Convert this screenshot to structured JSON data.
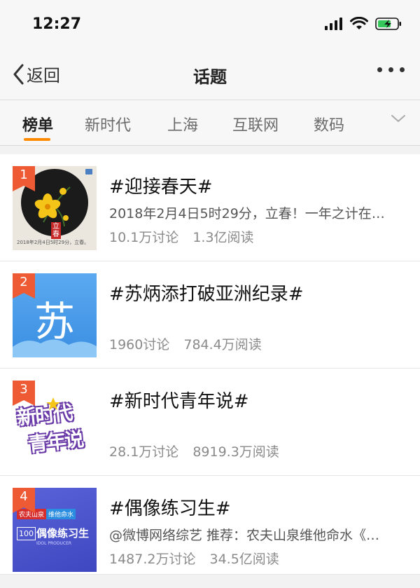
{
  "status": {
    "time": "12:27"
  },
  "nav": {
    "back_label": "返回",
    "title": "话题"
  },
  "tabs": [
    {
      "label": "榜单",
      "active": true
    },
    {
      "label": "新时代"
    },
    {
      "label": "上海"
    },
    {
      "label": "互联网"
    },
    {
      "label": "数码"
    }
  ],
  "topics": [
    {
      "rank": "1",
      "title": "#迎接春天#",
      "description": "2018年2月4日5时29分，立春！一年之计在…",
      "discussions": "10.1万讨论",
      "reads": "1.3亿阅读",
      "thumb_caption": "2018年2月4日5时29分，立春。",
      "thumb_stamp": "立春"
    },
    {
      "rank": "2",
      "title": "#苏炳添打破亚洲纪录#",
      "description": "",
      "discussions": "1960讨论",
      "reads": "784.4万阅读",
      "thumb_text": "苏"
    },
    {
      "rank": "3",
      "title": "#新时代青年说#",
      "description": "",
      "discussions": "28.1万讨论",
      "reads": "8919.3万阅读",
      "thumb_line1": "新时代",
      "thumb_line2": "青年说"
    },
    {
      "rank": "4",
      "title": "#偶像练习生#",
      "description": "@微博网络综艺 推荐：农夫山泉维他命水《…",
      "discussions": "1487.2万讨论",
      "reads": "34.5亿阅读",
      "thumb_brand": "农夫山泉",
      "thumb_sub": "维他命水",
      "thumb_show": "偶像练习生",
      "thumb_en": "IDOL PRODUCER",
      "thumb_num": "100"
    }
  ],
  "colors": {
    "accent": "#ff8a00",
    "badge": "#ee5a33",
    "battery": "#35c759"
  }
}
